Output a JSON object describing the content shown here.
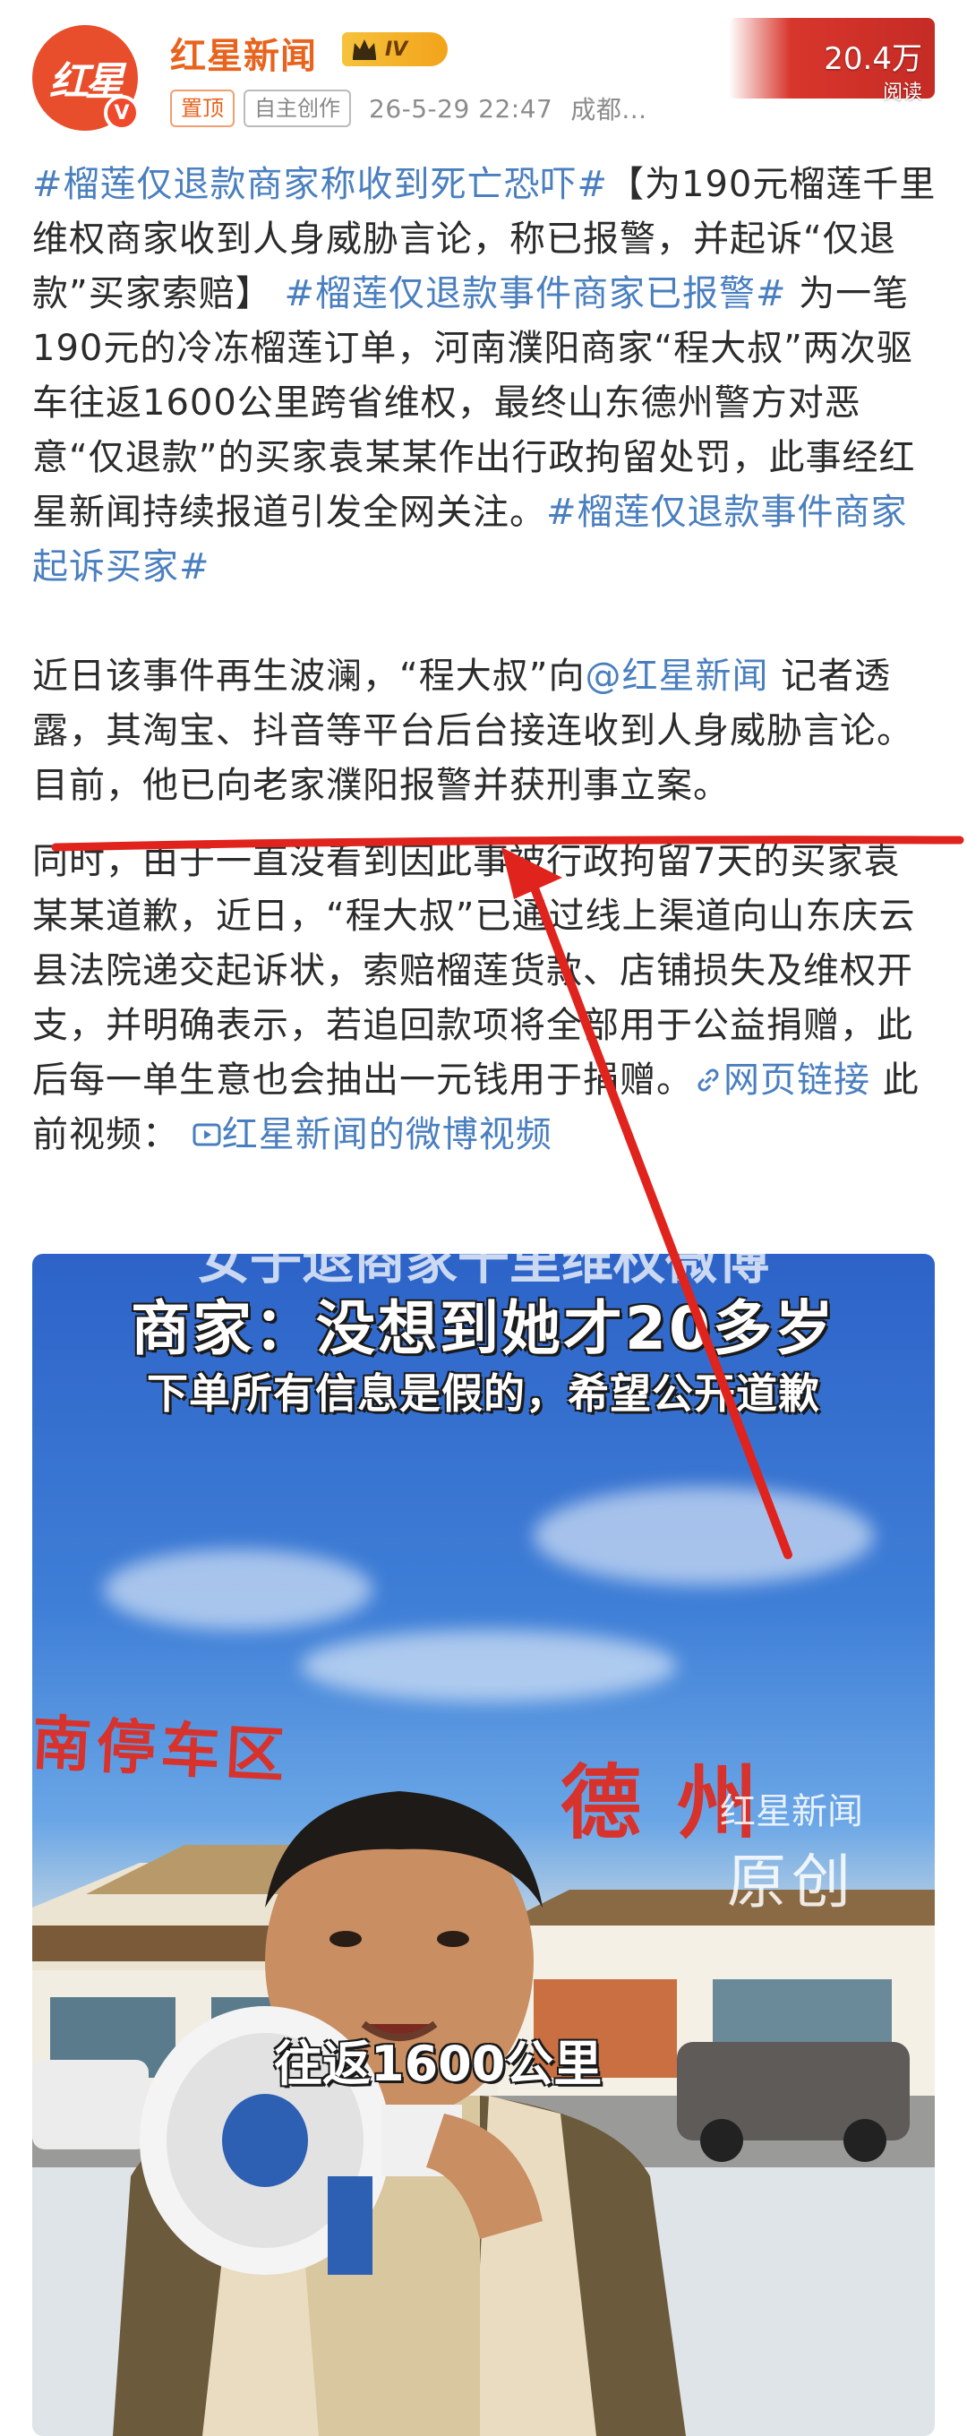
{
  "header": {
    "avatar_text": "红星",
    "author": "红星新闻",
    "level": "IV",
    "tags": {
      "pinned": "置顶",
      "original": "自主创作"
    },
    "timestamp": "26-5-29 22:47",
    "location": "成都...",
    "views_count": "20.4万",
    "views_label": "阅读"
  },
  "post": {
    "p1": {
      "tag1": "#榴莲仅退款商家称收到死亡恐吓#",
      "text1": "【为190元榴莲千里维权商家收到人身威胁言论，称已报警，并起诉“仅退款”买家索赔】 ",
      "tag2": "#榴莲仅退款事件商家已报警#",
      "text2": " 为一笔190元的冷冻榴莲订单，河南濮阳商家“程大叔”两次驱车往返1600公里跨省维权，最终山东德州警方对恶意“仅退款”的买家袁某某作出行政拘留处罚，此事经红星新闻持续报道引发全网关注。",
      "tag3": "#榴莲仅退款事件商家起诉买家#"
    },
    "p2": {
      "text1": "近日该事件再生波澜，“程大叔”向",
      "mention": "@红星新闻",
      "text2": " 记者透露，其淘宝、抖音等平台后台接连收到人身威胁言论。目前，他已向老家濮阳报警并获刑事立案。"
    },
    "p3": {
      "text1": "同时，由于一直没看到因此事被行政拘留7天的买家袁某某道歉，近日，“程大叔”已通过线上渠道向山东庆云县法院递交起诉状，索赔榴莲货款、店铺损失及维权开支，并明确表示，若追回款项将全部用于公益捐赠，此后每一单生意也会抽出一元钱用于捐赠。",
      "link_label": "网页链接",
      "text2": " 此前视频： ",
      "video_link": "红星新闻的微博视频"
    }
  },
  "video": {
    "top_cut": "女子退商家千里维权微博",
    "headline": "商家：没想到她才20多岁",
    "subline": "下单所有信息是假的，希望公开道歉",
    "sign_left": "南停车区",
    "sign_right": "德州",
    "watermark_line1": "红星新闻",
    "watermark_line2": "原创",
    "caption": "往返1600公里"
  },
  "colors": {
    "accent_orange": "#e8631d",
    "link_blue": "#4a7fbf",
    "annotation_red": "#e0231c"
  }
}
